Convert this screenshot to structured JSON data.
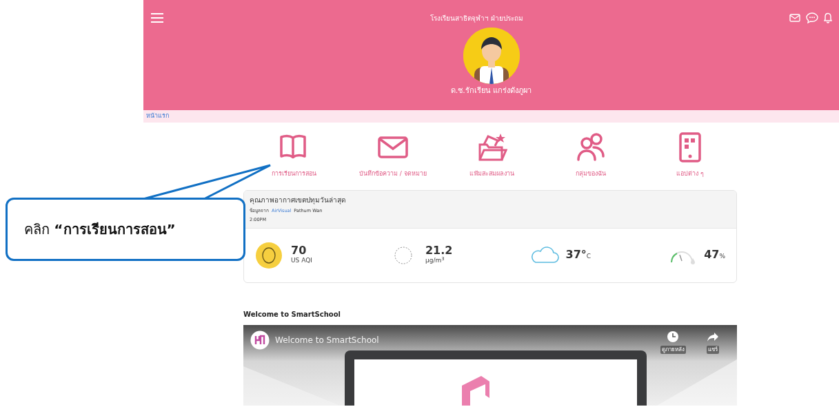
{
  "header": {
    "school": "โรงเรียนสาธิตจุฬาฯ ฝ่ายประถม",
    "user_name": "ด.ช.รักเรียน แกร่งดังภูผา"
  },
  "breadcrumb": "หน้าแรก",
  "menu": [
    {
      "kind": "book",
      "label": "การเรียนการสอน"
    },
    {
      "kind": "mail",
      "label": "บันทึกข้อความ / จดหมาย"
    },
    {
      "kind": "folder",
      "label": "แฟ้มสะสมผลงาน"
    },
    {
      "kind": "group",
      "label": "กลุ่มของฉัน"
    },
    {
      "kind": "apps",
      "label": "แอปต่าง ๆ"
    }
  ],
  "air_card": {
    "title": "คุณภาพอากาศเขตปทุมวันล่าสุด",
    "source_label": "ข้อมูลจาก",
    "source_link": "AirVisual",
    "location": "Pathum Wan",
    "time": "2:00PM",
    "readings": [
      {
        "kind": "aqi",
        "value": "70",
        "unit": "US AQI"
      },
      {
        "kind": "pm",
        "value": "21.2",
        "unit": "µg/m$^{3}$"
      },
      {
        "kind": "temp",
        "value": "37°",
        "unit": "C"
      },
      {
        "kind": "humidity",
        "value": "47",
        "unit": "%"
      }
    ]
  },
  "video": {
    "heading": "Welcome to SmartSchool",
    "title": "Welcome to SmartSchool",
    "actions": [
      {
        "kind": "clock",
        "label": "ดูภายหลัง"
      },
      {
        "kind": "share",
        "label": "แชร์"
      }
    ]
  },
  "callout": {
    "text": "คลิก **“การเรียนการสอน”**"
  }
}
